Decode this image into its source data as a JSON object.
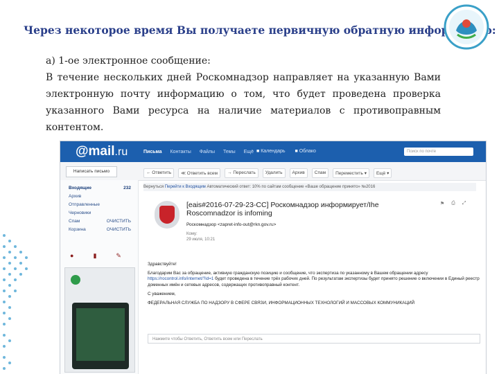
{
  "slide": {
    "title": "Через некоторое время Вы получаете первичную обратную информацию:",
    "subtitle": "а) 1-ое электронное сообщение:",
    "paragraph": "В течение нескольких дней Роскомнадзор направляет на указанную Вами электронную почту информацию о том, что будет проведена проверка указанного Вами ресурса на наличие материалов с противоправным контентом."
  },
  "mail": {
    "logo": "@mail",
    "logo_tld": ".ru",
    "nav": [
      "Письма",
      "Контакты",
      "Файлы",
      "Темы",
      "Ещё"
    ],
    "apps": [
      "Календарь",
      "Облако"
    ],
    "search_placeholder": "Поиск по почте",
    "compose": "Написать письмо",
    "toolbar": [
      "← Ответить",
      "≪ Ответить всем",
      "→ Переслать",
      "Удалить",
      "Архив",
      "Спам",
      "Переместить ▾",
      "Ещё ▾"
    ],
    "folders": [
      {
        "name": "Входящие",
        "count": "232"
      },
      {
        "name": "Архив",
        "count": ""
      },
      {
        "name": "Отправленные",
        "count": ""
      },
      {
        "name": "Черновики",
        "count": ""
      },
      {
        "name": "Спам",
        "count": "ОЧИСТИТЬ"
      },
      {
        "name": "Корзина",
        "count": "ОЧИСТИТЬ"
      }
    ],
    "subject_bar_prefix": "Вернуться",
    "subject_bar_link": "Перейти к Входящим",
    "subject_bar_text": "Автоматический ответ: 10% по сайтам сообщение «Ваше обращение принято» №2016",
    "subject": "[eais#2016-07-29-23-CC] Роскомнадзор информирует/Ihe Roscomnadzor is infoming",
    "sender": "Роскомнадзор <zapret-info-out@rkn.gov.ru>",
    "meta_to": "Кому:",
    "meta_date": "29 июля, 10:21",
    "greeting": "Здравствуйте!",
    "body": "Благодарим Вас за обращение, активную гражданскую позицию и сообщение, что экспертиза по указанному в Вашем обращении адресу",
    "body_link": "https://",
    "body_link2": "rocontrol.info/internet/?id=1",
    "body2": "будет проведена в течение трёх рабочих дней. По результатам экспертизы будет принято решение о включении в Единый реестр доменных имён и сетевых адресов, содержащих противоправный контент.",
    "regards": "С уважением,",
    "signature": "ФЕДЕРАЛЬНАЯ СЛУЖБА ПО НАДЗОРУ В СФЕРЕ СВЯЗИ, ИНФОРМАЦИОННЫХ ТЕХНОЛОГИЙ И МАССОВЫХ КОММУНИКАЦИЙ",
    "reply_placeholder": "Нажмите чтобы Ответить, Ответить всем или Переслать"
  }
}
